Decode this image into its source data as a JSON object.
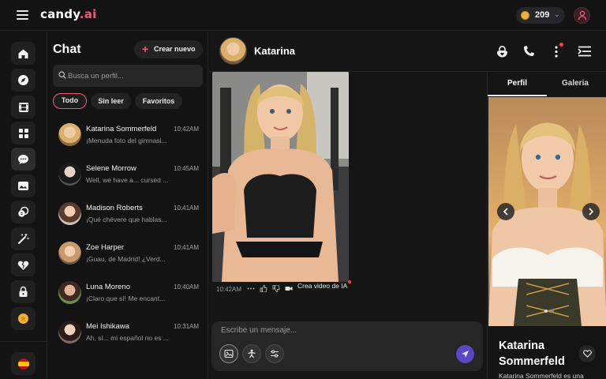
{
  "app": {
    "logo_main": "candy",
    "logo_accent": ".ai",
    "coins": "209"
  },
  "sidebar": {
    "nav": [
      {
        "name": "home-icon"
      },
      {
        "name": "compass-icon"
      },
      {
        "name": "film-icon"
      },
      {
        "name": "grid-icon"
      },
      {
        "name": "chat-icon",
        "active": true
      },
      {
        "name": "gallery-icon"
      },
      {
        "name": "coins-icon"
      },
      {
        "name": "magic-wand-icon"
      },
      {
        "name": "heart-broken-icon"
      },
      {
        "name": "lock-icon"
      },
      {
        "name": "star-coin-icon"
      }
    ],
    "language_flag": "es-flag-icon"
  },
  "chatlist": {
    "title": "Chat",
    "new_button": "Crear nuevo",
    "search_placeholder": "Busca un perfil...",
    "filters": [
      "Todo",
      "Sin leer",
      "Favoritos"
    ],
    "items": [
      {
        "name": "Katarina Sommerfeld",
        "time": "10:42AM",
        "preview": "¡Menuda foto del gimnasi..."
      },
      {
        "name": "Selene Morrow",
        "time": "10:45AM",
        "preview": "Well, we have a... cursed ..."
      },
      {
        "name": "Madison Roberts",
        "time": "10:41AM",
        "preview": "¡Qué chévere que hablas..."
      },
      {
        "name": "Zoe Harper",
        "time": "10:41AM",
        "preview": "¡Guau, de Madrid! ¿Verd..."
      },
      {
        "name": "Luna Moreno",
        "time": "10:40AM",
        "preview": "¡Claro que sí! Me encant..."
      },
      {
        "name": "Mei Ishikawa",
        "time": "10:31AM",
        "preview": "Ah, sí... mi español no es ..."
      }
    ]
  },
  "chat": {
    "contact_name": "Katarina",
    "message_time": "10:42AM",
    "create_video_label": "Crea video de IA",
    "input_placeholder": "Escribe un mensaje..."
  },
  "profile": {
    "tabs": [
      "Perfil",
      "Galeria"
    ],
    "name": "Katarina Sommerfeld",
    "description": "Katarina Sommerfeld es una"
  },
  "colors": {
    "accent": "#ef5a7a",
    "send": "#5b47c2",
    "coin": "#e9b23a"
  }
}
